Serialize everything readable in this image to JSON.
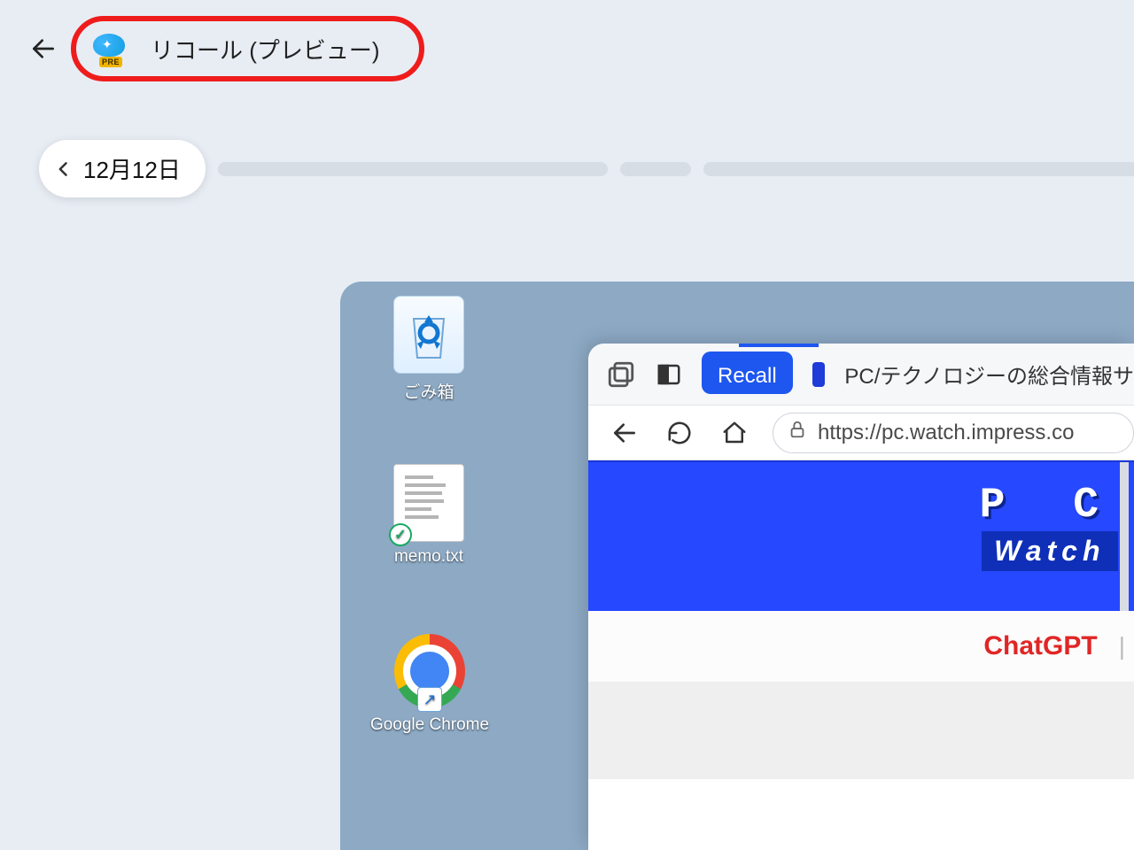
{
  "header": {
    "title": "リコール (プレビュー)",
    "icon_badge": "PRE"
  },
  "timeline": {
    "date_label": "12月12日"
  },
  "desktop": {
    "recycle_bin_label": "ごみ箱",
    "memo_label": "memo.txt",
    "chrome_label": "Google Chrome"
  },
  "browser": {
    "recall_tab_label": "Recall",
    "tab_title": "PC/テクノロジーの総合情報サ",
    "url": "https://pc.watch.impress.co",
    "banner_line1": "P C",
    "banner_line2": "Watch",
    "chatgpt_label": "ChatGPT",
    "separator": "|"
  }
}
